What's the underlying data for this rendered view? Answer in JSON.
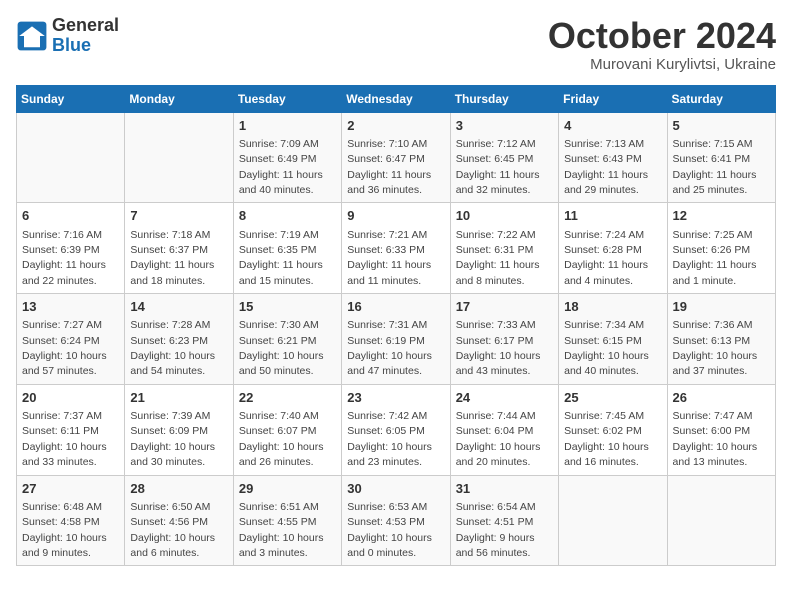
{
  "logo": {
    "general": "General",
    "blue": "Blue"
  },
  "title": "October 2024",
  "subtitle": "Murovani Kurylivtsi, Ukraine",
  "weekdays": [
    "Sunday",
    "Monday",
    "Tuesday",
    "Wednesday",
    "Thursday",
    "Friday",
    "Saturday"
  ],
  "weeks": [
    [
      null,
      null,
      {
        "day": 1,
        "sunrise": "7:09 AM",
        "sunset": "6:49 PM",
        "daylight": "11 hours and 40 minutes."
      },
      {
        "day": 2,
        "sunrise": "7:10 AM",
        "sunset": "6:47 PM",
        "daylight": "11 hours and 36 minutes."
      },
      {
        "day": 3,
        "sunrise": "7:12 AM",
        "sunset": "6:45 PM",
        "daylight": "11 hours and 32 minutes."
      },
      {
        "day": 4,
        "sunrise": "7:13 AM",
        "sunset": "6:43 PM",
        "daylight": "11 hours and 29 minutes."
      },
      {
        "day": 5,
        "sunrise": "7:15 AM",
        "sunset": "6:41 PM",
        "daylight": "11 hours and 25 minutes."
      }
    ],
    [
      {
        "day": 6,
        "sunrise": "7:16 AM",
        "sunset": "6:39 PM",
        "daylight": "11 hours and 22 minutes."
      },
      {
        "day": 7,
        "sunrise": "7:18 AM",
        "sunset": "6:37 PM",
        "daylight": "11 hours and 18 minutes."
      },
      {
        "day": 8,
        "sunrise": "7:19 AM",
        "sunset": "6:35 PM",
        "daylight": "11 hours and 15 minutes."
      },
      {
        "day": 9,
        "sunrise": "7:21 AM",
        "sunset": "6:33 PM",
        "daylight": "11 hours and 11 minutes."
      },
      {
        "day": 10,
        "sunrise": "7:22 AM",
        "sunset": "6:31 PM",
        "daylight": "11 hours and 8 minutes."
      },
      {
        "day": 11,
        "sunrise": "7:24 AM",
        "sunset": "6:28 PM",
        "daylight": "11 hours and 4 minutes."
      },
      {
        "day": 12,
        "sunrise": "7:25 AM",
        "sunset": "6:26 PM",
        "daylight": "11 hours and 1 minute."
      }
    ],
    [
      {
        "day": 13,
        "sunrise": "7:27 AM",
        "sunset": "6:24 PM",
        "daylight": "10 hours and 57 minutes."
      },
      {
        "day": 14,
        "sunrise": "7:28 AM",
        "sunset": "6:23 PM",
        "daylight": "10 hours and 54 minutes."
      },
      {
        "day": 15,
        "sunrise": "7:30 AM",
        "sunset": "6:21 PM",
        "daylight": "10 hours and 50 minutes."
      },
      {
        "day": 16,
        "sunrise": "7:31 AM",
        "sunset": "6:19 PM",
        "daylight": "10 hours and 47 minutes."
      },
      {
        "day": 17,
        "sunrise": "7:33 AM",
        "sunset": "6:17 PM",
        "daylight": "10 hours and 43 minutes."
      },
      {
        "day": 18,
        "sunrise": "7:34 AM",
        "sunset": "6:15 PM",
        "daylight": "10 hours and 40 minutes."
      },
      {
        "day": 19,
        "sunrise": "7:36 AM",
        "sunset": "6:13 PM",
        "daylight": "10 hours and 37 minutes."
      }
    ],
    [
      {
        "day": 20,
        "sunrise": "7:37 AM",
        "sunset": "6:11 PM",
        "daylight": "10 hours and 33 minutes."
      },
      {
        "day": 21,
        "sunrise": "7:39 AM",
        "sunset": "6:09 PM",
        "daylight": "10 hours and 30 minutes."
      },
      {
        "day": 22,
        "sunrise": "7:40 AM",
        "sunset": "6:07 PM",
        "daylight": "10 hours and 26 minutes."
      },
      {
        "day": 23,
        "sunrise": "7:42 AM",
        "sunset": "6:05 PM",
        "daylight": "10 hours and 23 minutes."
      },
      {
        "day": 24,
        "sunrise": "7:44 AM",
        "sunset": "6:04 PM",
        "daylight": "10 hours and 20 minutes."
      },
      {
        "day": 25,
        "sunrise": "7:45 AM",
        "sunset": "6:02 PM",
        "daylight": "10 hours and 16 minutes."
      },
      {
        "day": 26,
        "sunrise": "7:47 AM",
        "sunset": "6:00 PM",
        "daylight": "10 hours and 13 minutes."
      }
    ],
    [
      {
        "day": 27,
        "sunrise": "6:48 AM",
        "sunset": "4:58 PM",
        "daylight": "10 hours and 9 minutes."
      },
      {
        "day": 28,
        "sunrise": "6:50 AM",
        "sunset": "4:56 PM",
        "daylight": "10 hours and 6 minutes."
      },
      {
        "day": 29,
        "sunrise": "6:51 AM",
        "sunset": "4:55 PM",
        "daylight": "10 hours and 3 minutes."
      },
      {
        "day": 30,
        "sunrise": "6:53 AM",
        "sunset": "4:53 PM",
        "daylight": "10 hours and 0 minutes."
      },
      {
        "day": 31,
        "sunrise": "6:54 AM",
        "sunset": "4:51 PM",
        "daylight": "9 hours and 56 minutes."
      },
      null,
      null
    ]
  ]
}
